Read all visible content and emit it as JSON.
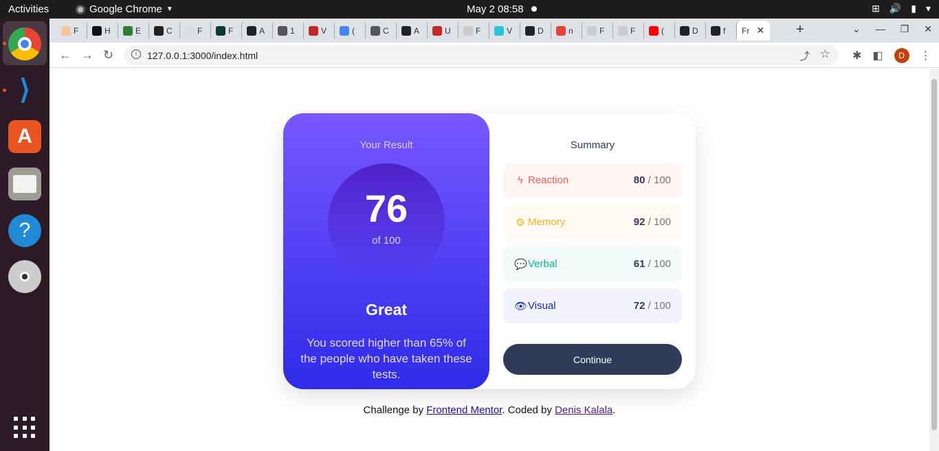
{
  "system": {
    "activities": "Activities",
    "app_name": "Google Chrome",
    "clock": "May 2  08:58"
  },
  "browser": {
    "tabs": [
      {
        "letter": "F",
        "color": "#f7c59f"
      },
      {
        "letter": "H",
        "color": "#111111"
      },
      {
        "letter": "E",
        "color": "#2e7d32"
      },
      {
        "letter": "C",
        "color": "#222222"
      },
      {
        "letter": "F",
        "color": "#dddddd"
      },
      {
        "letter": "F",
        "color": "#0b3b2e"
      },
      {
        "letter": "A",
        "color": "#222222"
      },
      {
        "letter": "1",
        "color": "#555555"
      },
      {
        "letter": "V",
        "color": "#c62828"
      },
      {
        "letter": "(",
        "color": "#4285f4"
      },
      {
        "letter": "C",
        "color": "#555555"
      },
      {
        "letter": "A",
        "color": "#222222"
      },
      {
        "letter": "U",
        "color": "#c62828"
      },
      {
        "letter": "F",
        "color": "#cccccc"
      },
      {
        "letter": "V",
        "color": "#26c6da"
      },
      {
        "letter": "D",
        "color": "#222222"
      },
      {
        "letter": "n",
        "color": "#ea4335"
      },
      {
        "letter": "F",
        "color": "#cccccc"
      },
      {
        "letter": "F",
        "color": "#cccccc"
      },
      {
        "letter": "(",
        "color": "#ff0000"
      },
      {
        "letter": "D",
        "color": "#222222"
      },
      {
        "letter": "f",
        "color": "#222222"
      }
    ],
    "active_tab_label": "Fr",
    "url": "127.0.0.1:3000/index.html",
    "profile_initial": "D"
  },
  "result": {
    "heading": "Your Result",
    "score": "76",
    "out_of": "of 100",
    "rank": "Great",
    "description": "You scored higher than 65% of the people who have taken these tests."
  },
  "summary": {
    "heading": "Summary",
    "items": [
      {
        "label": "Reaction",
        "score": "80",
        "max": " / 100",
        "icon": "lightning-icon",
        "glyph": "ϟ"
      },
      {
        "label": "Memory",
        "score": "92",
        "max": " / 100",
        "icon": "brain-icon",
        "glyph": "⚙"
      },
      {
        "label": "Verbal",
        "score": "61",
        "max": " / 100",
        "icon": "chat-icon",
        "glyph": "💬"
      },
      {
        "label": "Visual",
        "score": "72",
        "max": " / 100",
        "icon": "eye-icon",
        "glyph": "👁"
      }
    ],
    "continue_label": "Continue"
  },
  "attribution": {
    "prefix": "Challenge by ",
    "link1": "Frontend Mentor",
    "middle": ". Coded by ",
    "link2": "Denis Kalala",
    "suffix": "."
  }
}
